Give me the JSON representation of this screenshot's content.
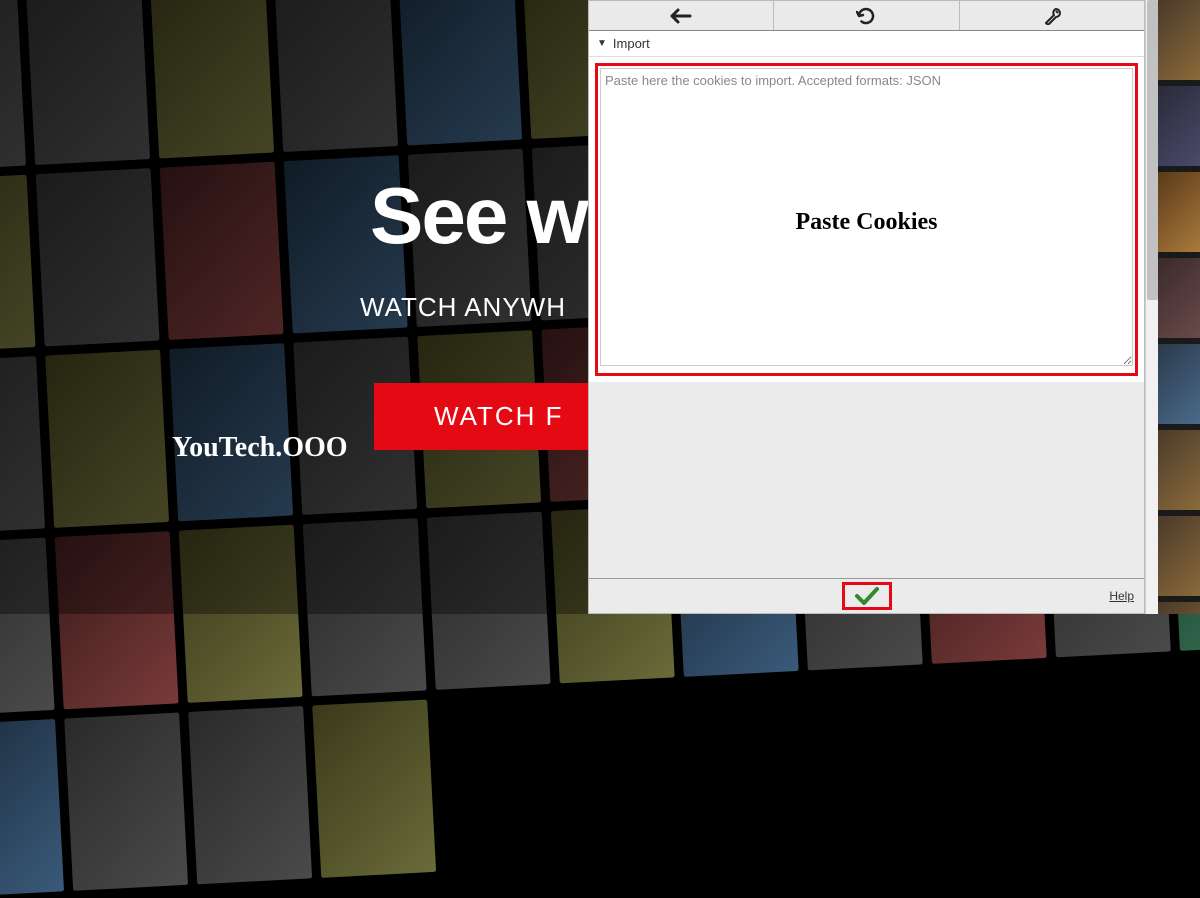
{
  "hero": {
    "title": "See w",
    "subtitle": "WATCH ANYWH",
    "cta": "WATCH F"
  },
  "watermark": "YouTech.OOO",
  "popup": {
    "section_label": "Import",
    "textarea_placeholder": "Paste here the cookies to import. Accepted formats: JSON",
    "overlay_label": "Paste Cookies",
    "help_text": "Help"
  },
  "icons": {
    "back": "←",
    "refresh": "↻",
    "wrench": "🔧",
    "check": "✓"
  },
  "colors": {
    "highlight": "#e50914",
    "confirm": "#2e8b2e"
  }
}
